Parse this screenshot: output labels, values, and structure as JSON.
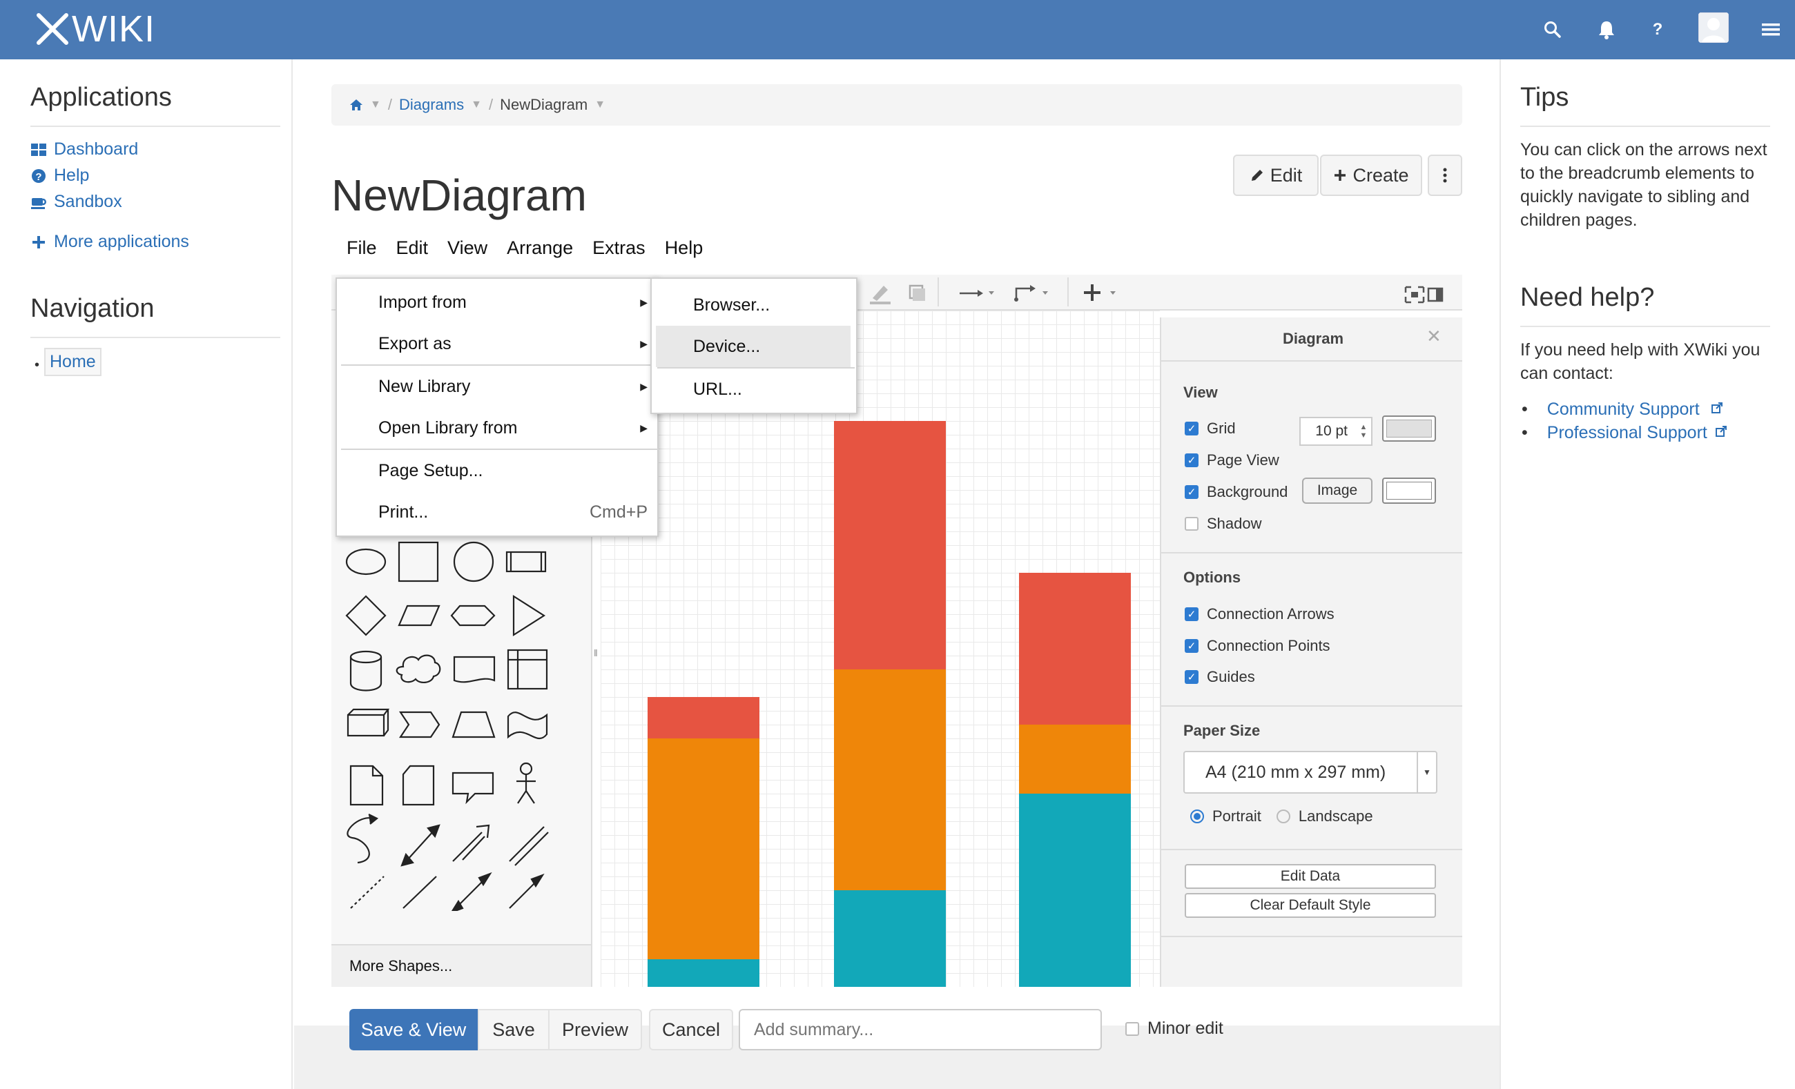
{
  "topbar": {
    "logo_text": "WIKI",
    "icons": [
      "search-icon",
      "bell-icon",
      "help-icon",
      "avatar",
      "hamburger-icon"
    ],
    "color": "#4a7ab5"
  },
  "left": {
    "applications_title": "Applications",
    "apps": [
      {
        "label": "Dashboard",
        "icon": "dashboard-icon"
      },
      {
        "label": "Help",
        "icon": "question-circle-icon"
      },
      {
        "label": "Sandbox",
        "icon": "coffee-icon"
      }
    ],
    "more_apps": "More applications",
    "navigation_title": "Navigation",
    "nav_home": "Home"
  },
  "breadcrumb": {
    "items": [
      "Diagrams",
      "NewDiagram"
    ]
  },
  "page": {
    "title": "NewDiagram",
    "edit": "Edit",
    "create": "Create"
  },
  "editor": {
    "menus": [
      "File",
      "Edit",
      "View",
      "Arrange",
      "Extras",
      "Help"
    ],
    "file_menu": {
      "items": [
        {
          "label": "Import from",
          "submenu": true
        },
        {
          "label": "Export as",
          "submenu": true
        },
        {
          "label": "New Library",
          "submenu": true
        },
        {
          "label": "Open Library from",
          "submenu": true
        },
        {
          "label": "Page Setup..."
        },
        {
          "label": "Print...",
          "shortcut": "Cmd+P"
        }
      ]
    },
    "import_submenu": [
      "Browser...",
      "Device...",
      "URL..."
    ],
    "more_shapes": "More Shapes...",
    "chart": {
      "colors": {
        "red": "#e65441",
        "orange": "#ef8609",
        "teal": "#12a8b9"
      },
      "bars": [
        {
          "teal": 1,
          "orange": 8,
          "red": 1.5
        },
        {
          "teal": 3.5,
          "orange": 8,
          "red": 9
        },
        {
          "teal": 7,
          "orange": 2.5,
          "red": 5.5
        }
      ]
    },
    "format_panel": {
      "title": "Diagram",
      "view_label": "View",
      "grid": "Grid",
      "grid_size": "10 pt",
      "page_view": "Page View",
      "background": "Background",
      "image_button": "Image",
      "shadow": "Shadow",
      "options_label": "Options",
      "connection_arrows": "Connection Arrows",
      "connection_points": "Connection Points",
      "guides": "Guides",
      "paper_size_label": "Paper Size",
      "paper_size": "A4 (210 mm x 297 mm)",
      "portrait": "Portrait",
      "landscape": "Landscape",
      "edit_data": "Edit Data",
      "clear_default_style": "Clear Default Style"
    }
  },
  "bottom": {
    "save_view": "Save & View",
    "save": "Save",
    "preview": "Preview",
    "cancel": "Cancel",
    "summary_placeholder": "Add summary...",
    "minor_edit": "Minor edit"
  },
  "right": {
    "tips_title": "Tips",
    "tips_text": "You can click on the arrows next to the breadcrumb elements to quickly navigate to sibling and children pages.",
    "help_title": "Need help?",
    "help_text": "If you need help with XWiki you can contact:",
    "links": [
      "Community Support",
      "Professional Support"
    ]
  }
}
